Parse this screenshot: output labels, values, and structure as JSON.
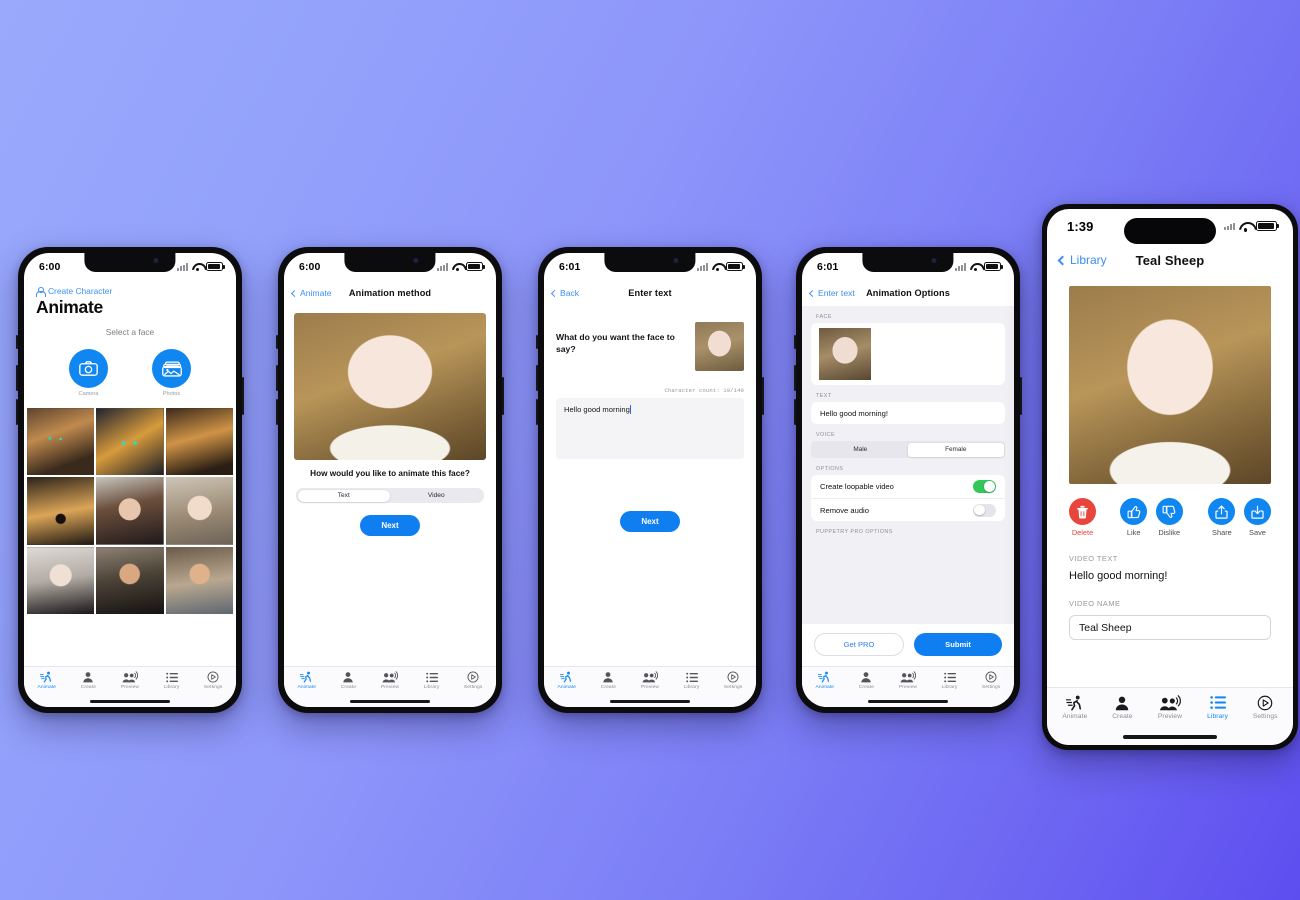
{
  "theme": {
    "accent": "#0f86f0",
    "danger": "#e8453c",
    "toggle_on": "#33c759",
    "bg_from": "#9aa9fb",
    "bg_to": "#5d4ef0"
  },
  "tabs": [
    {
      "label": "Animate",
      "icon": "running-person-icon"
    },
    {
      "label": "Create",
      "icon": "person-icon"
    },
    {
      "label": "Preview",
      "icon": "two-people-speaking-icon"
    },
    {
      "label": "Library",
      "icon": "list-icon"
    },
    {
      "label": "Settings",
      "icon": "gear-play-icon"
    }
  ],
  "phone1": {
    "status": {
      "time": "6:00"
    },
    "create_character": "Create Character",
    "title": "Animate",
    "subtitle": "Select a face",
    "buttons": [
      {
        "label": "Camera",
        "icon": "camera-icon"
      },
      {
        "label": "Photos",
        "icon": "photos-icon"
      }
    ],
    "gallery": [
      "cat-tabby-face",
      "cat-orange-face",
      "dog-shepherd-face",
      "dog-husky-face",
      "woman-bob-brunette-face",
      "woman-pale-blonde-face",
      "woman-curly-dark-face",
      "man-bearded-face",
      "man-short-hair-face"
    ],
    "active_tab": "Animate"
  },
  "phone2": {
    "status": {
      "time": "6:00"
    },
    "nav": {
      "back": "Animate",
      "title": "Animation method"
    },
    "hero_alt": "woman-portrait-gold-background",
    "question": "How would you like to animate this face?",
    "segment": {
      "options": [
        "Text",
        "Video"
      ],
      "selected": "Text"
    },
    "next_label": "Next",
    "active_tab": "Animate"
  },
  "phone3": {
    "status": {
      "time": "6:01"
    },
    "nav": {
      "back": "Back",
      "title": "Enter text"
    },
    "prompt": "What do you want the face to say?",
    "thumb_alt": "woman-portrait-thumbnail",
    "character_count": "Character count: 19/140",
    "textarea_value": "Hello good morning",
    "next_label": "Next",
    "active_tab": "Animate"
  },
  "phone4": {
    "status": {
      "time": "6:01"
    },
    "nav": {
      "back": "Enter text",
      "title": "Animation Options"
    },
    "sections": {
      "face": "FACE",
      "text": "TEXT",
      "voice": "VOICE",
      "options": "OPTIONS",
      "pro": "PUPPETRY PRO OPTIONS"
    },
    "text_value": "Hello good morning!",
    "voice": {
      "options": [
        "Male",
        "Female"
      ],
      "selected": "Female"
    },
    "toggles": [
      {
        "label": "Create loopable video",
        "on": true
      },
      {
        "label": "Remove audio",
        "on": false
      }
    ],
    "get_pro_label": "Get PRO",
    "submit_label": "Submit",
    "active_tab": "Animate"
  },
  "phone5": {
    "status": {
      "time": "1:39"
    },
    "nav": {
      "back": "Library",
      "title": "Teal Sheep"
    },
    "hero_alt": "woman-portrait-gold-background",
    "actions": [
      {
        "label": "Delete",
        "icon": "trash-icon",
        "style": "danger"
      },
      {
        "label": "Like",
        "icon": "thumbs-up-icon",
        "style": "accent"
      },
      {
        "label": "Dislike",
        "icon": "thumbs-down-icon",
        "style": "accent"
      },
      {
        "label": "Share",
        "icon": "share-icon",
        "style": "accent"
      },
      {
        "label": "Save",
        "icon": "save-icon",
        "style": "accent"
      }
    ],
    "video_text_label": "VIDEO TEXT",
    "video_text_value": "Hello good morning!",
    "video_name_label": "VIDEO NAME",
    "video_name_value": "Teal Sheep",
    "active_tab": "Library"
  }
}
